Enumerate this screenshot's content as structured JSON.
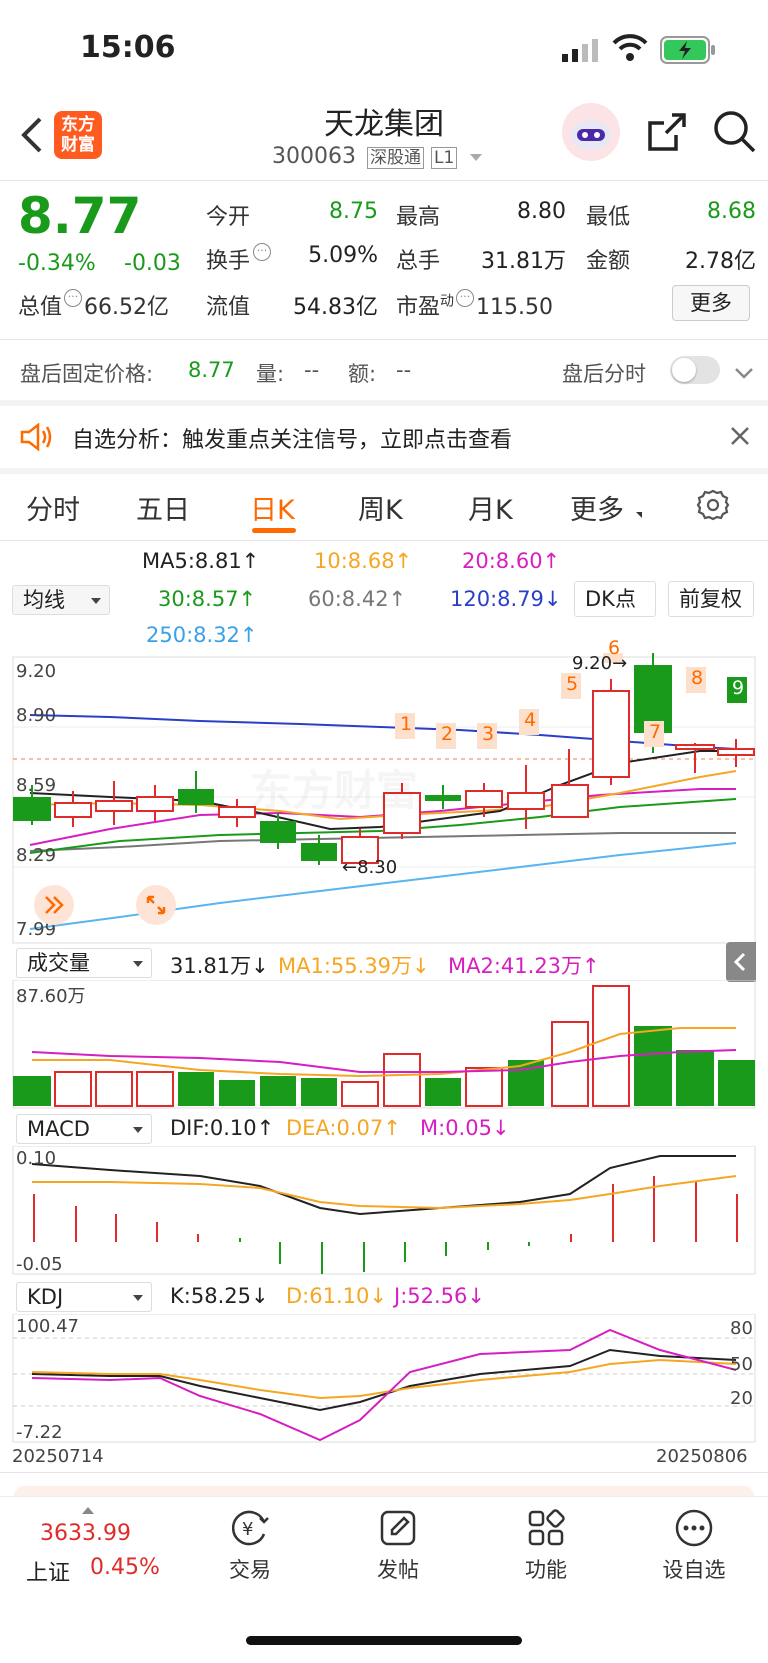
{
  "status_bar": {
    "time": "15:06"
  },
  "header": {
    "logo_text": "东方财富",
    "title": "天龙集团",
    "code": "300063",
    "exchange_badge": "深股通",
    "level_badge": "L1"
  },
  "quote": {
    "price": "8.77",
    "change_pct": "-0.34%",
    "change": "-0.03",
    "open_label": "今开",
    "open": "8.75",
    "high_label": "最高",
    "high": "8.80",
    "low_label": "最低",
    "low": "8.68",
    "turnover_label": "换手",
    "turnover": "5.09%",
    "volume_label": "总手",
    "volume": "31.81万",
    "amount_label": "金额",
    "amount": "2.78亿",
    "mcap_label": "总值",
    "mcap": "66.52亿",
    "float_label": "流值",
    "float_cap": "54.83亿",
    "pe_label": "市盈",
    "pe_sup": "动",
    "pe": "115.50",
    "more_btn": "更多"
  },
  "after_hours": {
    "label": "盘后固定价格:",
    "price": "8.77",
    "vol_label": "量:",
    "vol": "--",
    "amt_label": "额:",
    "amt": "--",
    "toggle_label": "盘后分时"
  },
  "banner": {
    "text": "自选分析：触发重点关注信号，立即点击查看"
  },
  "tabs": [
    {
      "label": "分时"
    },
    {
      "label": "五日"
    },
    {
      "label": "日K"
    },
    {
      "label": "周K"
    },
    {
      "label": "月K"
    },
    {
      "label": "更多"
    }
  ],
  "ma_bar": {
    "selector": "均线",
    "ma5": "MA5:8.81↑",
    "ma10": "10:8.68↑",
    "ma20": "20:8.60↑",
    "ma30": "30:8.57↑",
    "ma60": "60:8.42↑",
    "ma120": "120:8.79↓",
    "ma250": "250:8.32↑",
    "dk_btn": "DK点",
    "adjust_btn": "前复权"
  },
  "kline": {
    "y_labels": [
      "9.20",
      "8.90",
      "8.59",
      "8.29",
      "7.99"
    ],
    "high_marker": "9.20→",
    "low_marker": "←8.30",
    "signal_numbers": [
      "1",
      "2",
      "3",
      "4",
      "5",
      "6",
      "7",
      "8",
      "9"
    ],
    "watermark": "东方财富"
  },
  "volume": {
    "selector": "成交量",
    "vol": "31.81万↓",
    "ma1": "MA1:55.39万↓",
    "ma2": "MA2:41.23万↑",
    "max_label": "87.60万"
  },
  "macd": {
    "selector": "MACD",
    "dif": "DIF:0.10↑",
    "dea": "DEA:0.07↑",
    "m": "M:0.05↓",
    "top": "0.10",
    "bottom": "-0.05"
  },
  "kdj": {
    "selector": "KDJ",
    "k": "K:58.25↓",
    "d": "D:61.10↓",
    "j": "J:52.56↓",
    "top": "100.47",
    "bottom": "-7.22",
    "r80": "80",
    "r50": "50",
    "r20": "20"
  },
  "dates": {
    "start": "20250714",
    "end": "20250806"
  },
  "bottom_nav": {
    "index_value": "3633.99",
    "index_name": "上证",
    "index_change": "0.45%",
    "items": [
      {
        "label": "交易"
      },
      {
        "label": "发帖"
      },
      {
        "label": "功能"
      },
      {
        "label": "设自选"
      }
    ]
  },
  "colors": {
    "up": "#e02b2b",
    "down": "#1a9a1a",
    "accent": "#ff6a00"
  }
}
